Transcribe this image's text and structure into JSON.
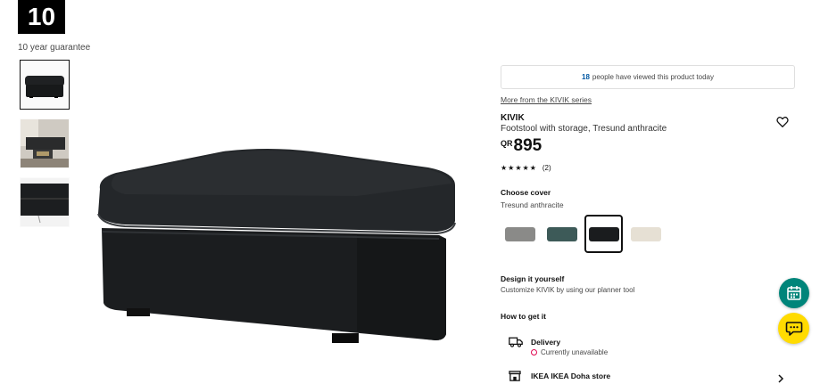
{
  "guarantee": {
    "years": "10",
    "text": "10 year guarantee"
  },
  "gallery": {
    "thumbnails": [
      "footstool-front-thumbnail",
      "room-scene-thumbnail",
      "fabric-closeup-thumbnail"
    ],
    "selected_index": 0
  },
  "social_proof": {
    "count": "18",
    "text": "people have viewed this product today"
  },
  "product": {
    "series_link": "More from the KIVIK series",
    "name": "KIVIK",
    "description": "Footstool with storage, Tresund anthracite",
    "currency": "QR",
    "price": "895",
    "stars": "★★★★★",
    "rating_value": 5,
    "review_count": "(2)"
  },
  "cover": {
    "title": "Choose cover",
    "selected_name": "Tresund anthracite",
    "swatches": [
      {
        "name": "swatch-grey",
        "color": "#8a8a88"
      },
      {
        "name": "swatch-dark-turquoise",
        "color": "#3d5a58"
      },
      {
        "name": "swatch-tresund-anthracite",
        "color": "#1a1c1e"
      },
      {
        "name": "swatch-beige",
        "color": "#e6e0d4"
      }
    ],
    "selected_index": 2
  },
  "design": {
    "title": "Design it yourself",
    "subtitle": "Customize KIVIK by using our planner tool"
  },
  "how_to_get": {
    "title": "How to get it",
    "delivery_label": "Delivery",
    "delivery_status": "Currently unavailable",
    "store_label": "IKEA IKEA Doha store"
  },
  "colors": {
    "accent_blue": "#0058a3",
    "planner_green": "#00857a",
    "chat_yellow": "#ffdb00",
    "unavailable_red": "#e00751"
  }
}
